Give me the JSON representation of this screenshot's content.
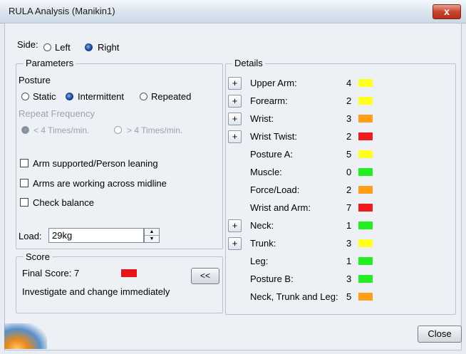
{
  "window": {
    "title": "RULA Analysis (Manikin1)",
    "close_glyph": "x"
  },
  "side": {
    "label": "Side:",
    "options": [
      "Left",
      "Right"
    ],
    "selected": "Right"
  },
  "parameters": {
    "legend": "Parameters",
    "posture_label": "Posture",
    "posture_options": [
      "Static",
      "Intermittent",
      "Repeated"
    ],
    "posture_selected": "Intermittent",
    "repeat_label": "Repeat Frequency",
    "repeat_options": [
      "< 4 Times/min.",
      "> 4 Times/min."
    ],
    "repeat_selected": "< 4 Times/min.",
    "checkboxes": [
      "Arm supported/Person leaning",
      "Arms are working across midline",
      "Check balance"
    ],
    "load_label": "Load:",
    "load_value": "29kg"
  },
  "score": {
    "legend": "Score",
    "final_label": "Final Score: 7",
    "final_color": "#e8141c",
    "message": "Investigate and change immediately",
    "collapse_button": "<<"
  },
  "details": {
    "legend": "Details",
    "rows": [
      {
        "label": "Upper Arm:",
        "value": "4",
        "expandable": true,
        "color": "#ffff1e"
      },
      {
        "label": "Forearm:",
        "value": "2",
        "expandable": true,
        "color": "#ffff1e"
      },
      {
        "label": "Wrist:",
        "value": "3",
        "expandable": true,
        "color": "#ff9f18"
      },
      {
        "label": "Wrist Twist:",
        "value": "2",
        "expandable": true,
        "color": "#ee1c1c"
      },
      {
        "label": "Posture A:",
        "value": "5",
        "expandable": false,
        "color": "#ffff1e"
      },
      {
        "label": "Muscle:",
        "value": "0",
        "expandable": false,
        "color": "#22ee22"
      },
      {
        "label": "Force/Load:",
        "value": "2",
        "expandable": false,
        "color": "#ff9f18"
      },
      {
        "label": "Wrist and Arm:",
        "value": "7",
        "expandable": false,
        "color": "#ee1c1c"
      },
      {
        "label": "Neck:",
        "value": "1",
        "expandable": true,
        "color": "#22ee22"
      },
      {
        "label": "Trunk:",
        "value": "3",
        "expandable": true,
        "color": "#ffff1e"
      },
      {
        "label": "Leg:",
        "value": "1",
        "expandable": false,
        "color": "#22ee22"
      },
      {
        "label": "Posture B:",
        "value": "3",
        "expandable": false,
        "color": "#22ee22"
      },
      {
        "label": "Neck, Trunk and Leg:",
        "value": "5",
        "expandable": false,
        "color": "#ff9f18"
      }
    ]
  },
  "footer": {
    "close_button": "Close"
  },
  "colors": {
    "yellow": "#ffff1e",
    "orange": "#ff9f18",
    "red": "#ee1c1c",
    "green": "#22ee22"
  }
}
